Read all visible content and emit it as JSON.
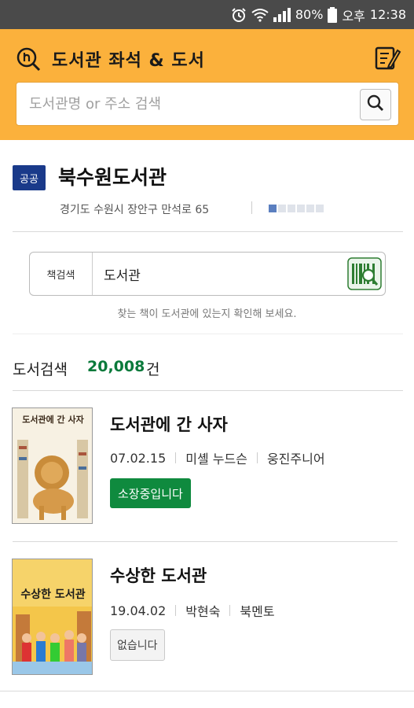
{
  "status_bar": {
    "battery": "80%",
    "period": "오후",
    "time": "12:38"
  },
  "header": {
    "title": "도서관  좌석 & 도서",
    "search_placeholder": "도서관명 or 주소 검색"
  },
  "library": {
    "badge": "공공",
    "name": "북수원도서관",
    "address": "경기도 수원시 장안구 만석로 65"
  },
  "book_search": {
    "label": "책검색",
    "value": "도서관",
    "hint": "찾는 책이 도서관에 있는지 확인해 보세요."
  },
  "results": {
    "label": "도서검색",
    "count": "20,008",
    "unit": "건",
    "items": [
      {
        "title": "도서관에 간 사자",
        "date": "07.02.15",
        "author": "미셸 누드슨",
        "publisher": "웅진주니어",
        "status": "소장중입니다",
        "cover_text": "도서관에 간 사자"
      },
      {
        "title": "수상한 도서관",
        "date": "19.04.02",
        "author": "박현숙",
        "publisher": "북멘토",
        "status": "없습니다",
        "cover_text": "수상한 도서관"
      }
    ]
  },
  "colors": {
    "header_bg": "#fbb13c",
    "badge_bg": "#1a3a8a",
    "accent_green": "#0f8a3e",
    "count_green": "#0a7a3b"
  }
}
